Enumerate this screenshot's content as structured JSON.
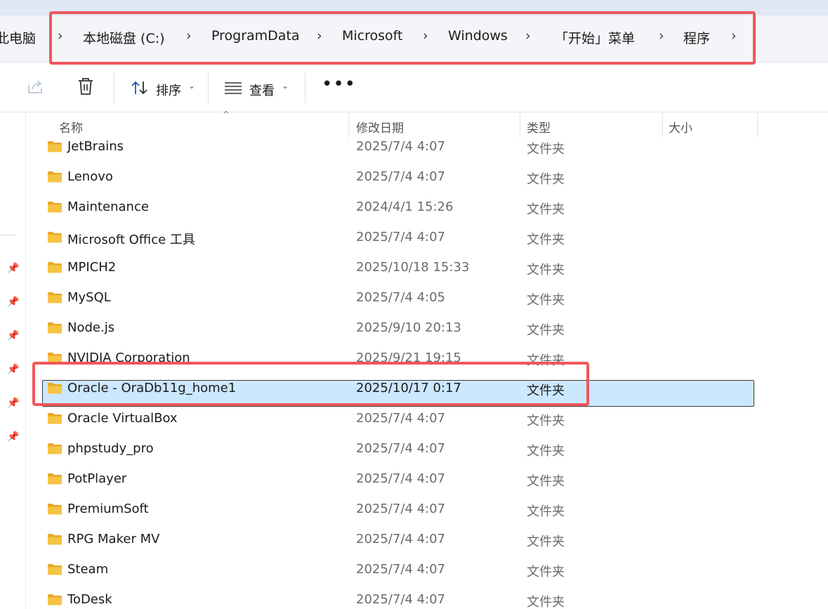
{
  "breadcrumb": {
    "items": [
      "此电脑",
      "本地磁盘 (C:)",
      "ProgramData",
      "Microsoft",
      "Windows",
      "「开始」菜单",
      "程序"
    ],
    "separator": "›"
  },
  "toolbar": {
    "share_icon": "share-icon",
    "delete_icon": "trash-icon",
    "sort_label": "排序",
    "view_label": "查看",
    "more_icon": "more-icon"
  },
  "columns": {
    "name": "名称",
    "date": "修改日期",
    "type": "类型",
    "size": "大小"
  },
  "files": [
    {
      "name": "JetBrains",
      "date": "2025/7/4 4:07",
      "type": "文件夹"
    },
    {
      "name": "Lenovo",
      "date": "2025/7/4 4:07",
      "type": "文件夹"
    },
    {
      "name": "Maintenance",
      "date": "2024/4/1 15:26",
      "type": "文件夹"
    },
    {
      "name": "Microsoft Office 工具",
      "date": "2025/7/4 4:07",
      "type": "文件夹"
    },
    {
      "name": "MPICH2",
      "date": "2025/10/18 15:33",
      "type": "文件夹"
    },
    {
      "name": "MySQL",
      "date": "2025/7/4 4:05",
      "type": "文件夹"
    },
    {
      "name": "Node.js",
      "date": "2025/9/10 20:13",
      "type": "文件夹"
    },
    {
      "name": "NVIDIA Corporation",
      "date": "2025/9/21 19:15",
      "type": "文件夹"
    },
    {
      "name": "Oracle - OraDb11g_home1",
      "date": "2025/10/17 0:17",
      "type": "文件夹",
      "selected": true
    },
    {
      "name": "Oracle VirtualBox",
      "date": "2025/7/4 4:07",
      "type": "文件夹"
    },
    {
      "name": "phpstudy_pro",
      "date": "2025/7/4 4:07",
      "type": "文件夹"
    },
    {
      "name": "PotPlayer",
      "date": "2025/7/4 4:07",
      "type": "文件夹"
    },
    {
      "name": "PremiumSoft",
      "date": "2025/7/4 4:07",
      "type": "文件夹"
    },
    {
      "name": "RPG Maker MV",
      "date": "2025/7/4 4:07",
      "type": "文件夹"
    },
    {
      "name": "Steam",
      "date": "2025/7/4 4:07",
      "type": "文件夹"
    },
    {
      "name": "ToDesk",
      "date": "2025/7/4 4:07",
      "type": "文件夹"
    }
  ],
  "colors": {
    "selection": "#cce8ff",
    "annotation": "#f0565b",
    "folder": "#f6c443"
  }
}
